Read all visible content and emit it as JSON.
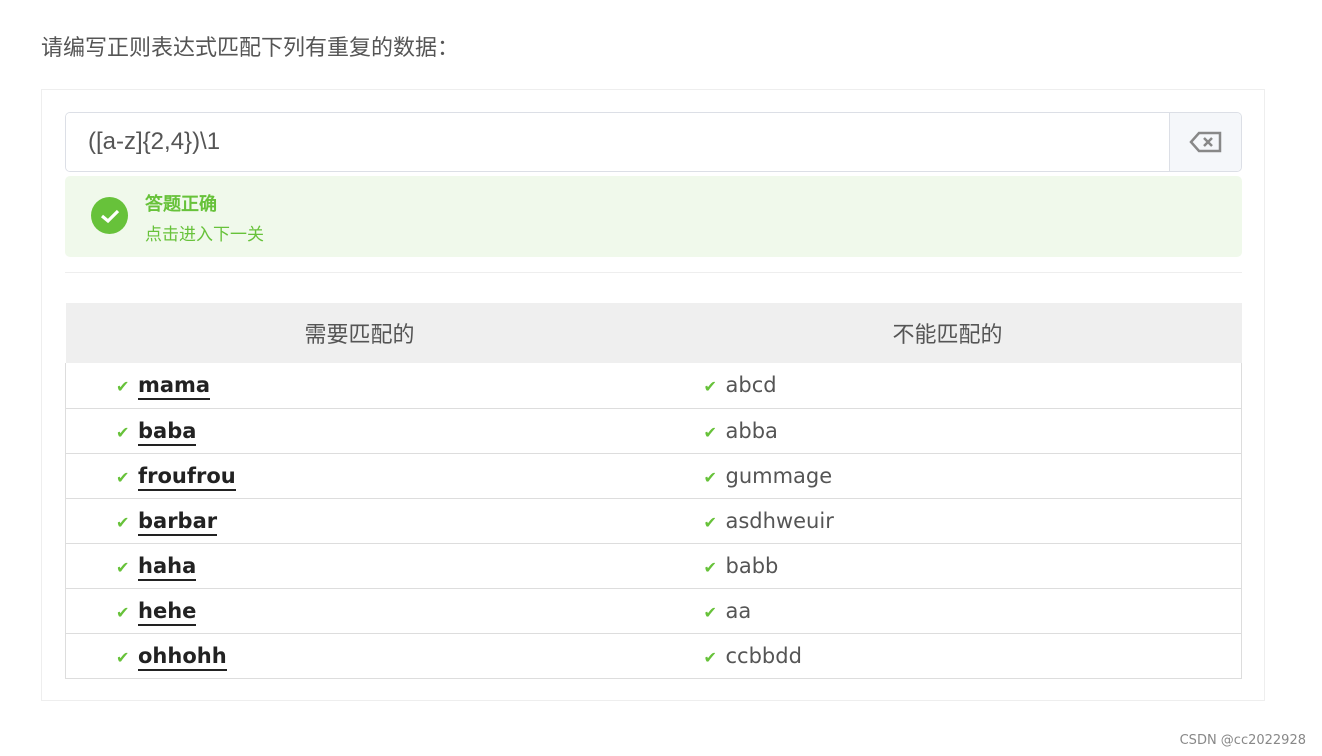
{
  "title": "请编写正则表达式匹配下列有重复的数据：",
  "input": {
    "value": "([a-z]{2,4})\\1"
  },
  "alert": {
    "title": "答题正确",
    "subtitle": "点击进入下一关",
    "color": "#67c23a"
  },
  "table": {
    "headers": [
      "需要匹配的",
      "不能匹配的"
    ],
    "rows": [
      [
        "mama",
        "abcd"
      ],
      [
        "baba",
        "abba"
      ],
      [
        "froufrou",
        "gummage"
      ],
      [
        "barbar",
        "asdhweuir"
      ],
      [
        "haha",
        "babb"
      ],
      [
        "hehe",
        "aa"
      ],
      [
        "ohhohh",
        "ccbbdd"
      ]
    ]
  },
  "footer": "CSDN @cc2022928"
}
